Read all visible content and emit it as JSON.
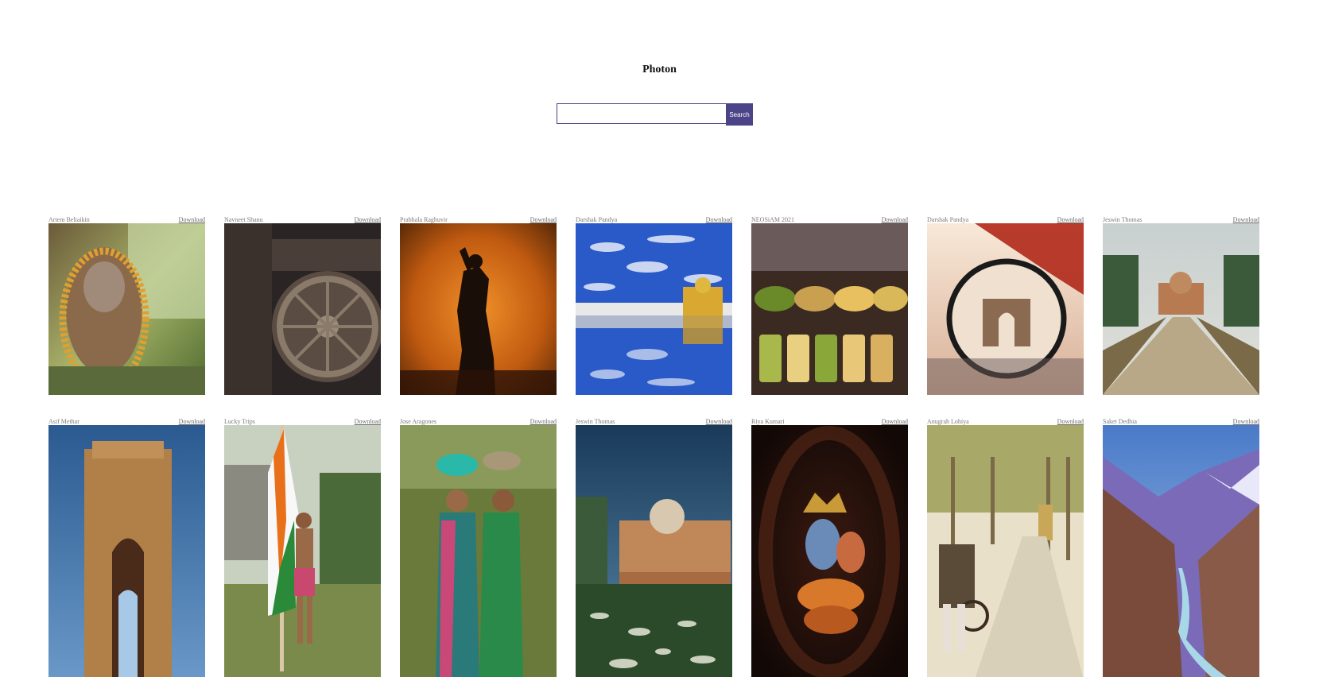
{
  "app": {
    "brand": "Photon"
  },
  "search": {
    "value": "",
    "placeholder": "",
    "button_label": "Search"
  },
  "download_label": "Download",
  "photos_row1": [
    {
      "author": "Artem Beliaikin",
      "subject": "ganesha-idol"
    },
    {
      "author": "Navneet Shanu",
      "subject": "konark-wheel"
    },
    {
      "author": "Prabhala Raghuvir",
      "subject": "fire-ritual-silhouette"
    },
    {
      "author": "Darshak Pandya",
      "subject": "golden-temple-reflection"
    },
    {
      "author": "NEOSiAM 2021",
      "subject": "spice-market"
    },
    {
      "author": "Darshak Pandya",
      "subject": "gateway-through-lens"
    },
    {
      "author": "Jeswin Thomas",
      "subject": "safdarjung-tomb-avenue"
    }
  ],
  "photos_row2": [
    {
      "author": "Asif Methar",
      "subject": "india-gate"
    },
    {
      "author": "Lucky Trips",
      "subject": "boy-with-flag"
    },
    {
      "author": "Jose Aragones",
      "subject": "women-carrying-baskets"
    },
    {
      "author": "Jeswin Thomas",
      "subject": "safdarjung-tomb-garden"
    },
    {
      "author": "Riya Kumari",
      "subject": "krishna-idol"
    },
    {
      "author": "Anugrah Lohiya",
      "subject": "bullock-cart-road"
    },
    {
      "author": "Saket Dedhia",
      "subject": "mountain-valley-river"
    }
  ]
}
